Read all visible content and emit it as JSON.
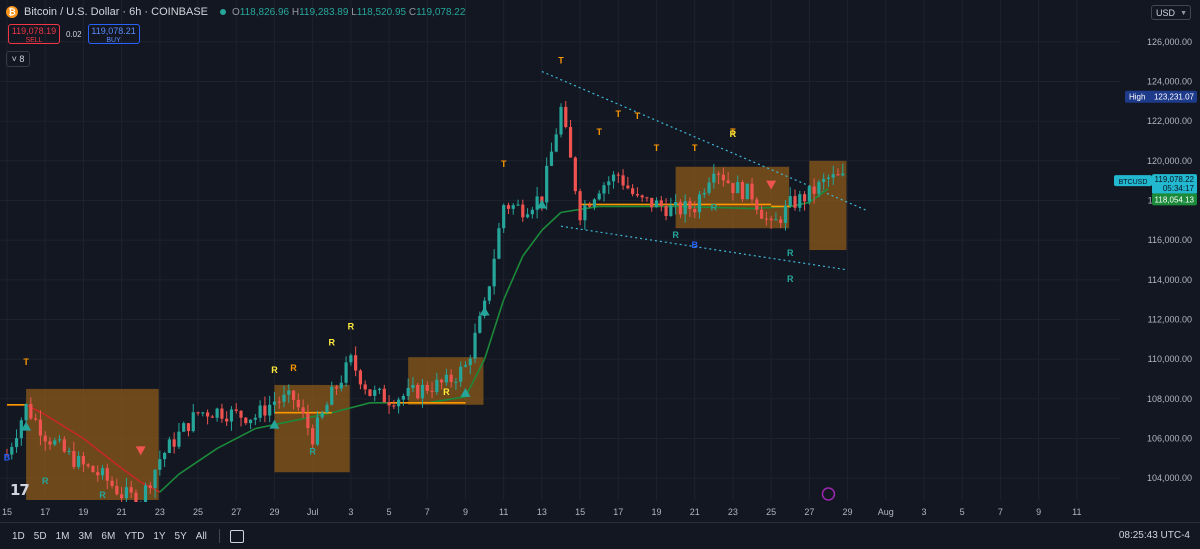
{
  "header": {
    "symbol": "Bitcoin / U.S. Dollar · 6h · COINBASE",
    "open_label": "O",
    "open": "118,826.96",
    "high_label": "H",
    "high": "119,283.89",
    "low_label": "L",
    "low": "118,520.95",
    "close_label": "C",
    "close": "119,078.22"
  },
  "trade": {
    "sell_price": "119,078.19",
    "sell_label": "SELL",
    "spread": "0.02",
    "buy_price": "119,078.21",
    "buy_label": "BUY"
  },
  "indicators_count": "8",
  "currency": "USD",
  "price_axis": {
    "ticks": [
      "126,000.00",
      "124,000.00",
      "122,000.00",
      "120,000.00",
      "118,000.00",
      "116,000.00",
      "114,000.00",
      "112,000.00",
      "110,000.00",
      "108,000.00",
      "106,000.00",
      "104,000.00"
    ],
    "tick_values": [
      126000,
      124000,
      122000,
      120000,
      118000,
      116000,
      114000,
      112000,
      110000,
      108000,
      106000,
      104000
    ],
    "high_tag_label": "High",
    "high_tag_value": "123,231.07",
    "high_value": 123231.07,
    "symbol_tag": "BTCUSD",
    "last_price": "119,078.22",
    "last_value": 119078.22,
    "countdown": "05:34:17",
    "ma_price": "118,054.13",
    "ma_value": 118054.13
  },
  "time_axis": {
    "labels": [
      "15",
      "17",
      "19",
      "21",
      "23",
      "25",
      "27",
      "29",
      "Jul",
      "3",
      "5",
      "7",
      "9",
      "11",
      "13",
      "15",
      "17",
      "19",
      "21",
      "23",
      "25",
      "27",
      "29",
      "Aug",
      "3",
      "5",
      "7",
      "9",
      "11"
    ]
  },
  "timeframes": [
    "1D",
    "5D",
    "1M",
    "3M",
    "6M",
    "YTD",
    "1Y",
    "5Y",
    "All"
  ],
  "clock": "08:25:43 UTC-4",
  "watermark": "17",
  "colors": {
    "bg": "#131722",
    "up": "#26a69a",
    "down": "#ef5350",
    "range_box": "#8b5a1a",
    "ma_up": "#1b8a3a",
    "ma_down": "#c62828",
    "trend": "#3fb8d8",
    "level": "#ff9800"
  },
  "chart_data": {
    "type": "candlestick",
    "title": "Bitcoin / U.S. Dollar · 6h · COINBASE",
    "xlabel": "",
    "ylabel": "",
    "ylim": [
      102900,
      127300
    ],
    "x_range": [
      "2025-06-15",
      "2025-08-12"
    ],
    "grid": true,
    "close_path": [
      {
        "t": "2025-06-15",
        "p": 105200
      },
      {
        "t": "2025-06-16",
        "p": 107600
      },
      {
        "t": "2025-06-17",
        "p": 106200
      },
      {
        "t": "2025-06-18",
        "p": 105300
      },
      {
        "t": "2025-06-19",
        "p": 104600
      },
      {
        "t": "2025-06-20",
        "p": 104100
      },
      {
        "t": "2025-06-21",
        "p": 103200
      },
      {
        "t": "2025-06-22",
        "p": 102900
      },
      {
        "t": "2025-06-23",
        "p": 105000
      },
      {
        "t": "2025-06-24",
        "p": 106200
      },
      {
        "t": "2025-06-25",
        "p": 107300
      },
      {
        "t": "2025-06-26",
        "p": 107400
      },
      {
        "t": "2025-06-27",
        "p": 107200
      },
      {
        "t": "2025-06-28",
        "p": 107100
      },
      {
        "t": "2025-06-29",
        "p": 107900
      },
      {
        "t": "2025-06-30",
        "p": 108000
      },
      {
        "t": "2025-07-01",
        "p": 106100
      },
      {
        "t": "2025-07-02",
        "p": 108200
      },
      {
        "t": "2025-07-03",
        "p": 109900
      },
      {
        "t": "2025-07-04",
        "p": 108300
      },
      {
        "t": "2025-07-05",
        "p": 108000
      },
      {
        "t": "2025-07-06",
        "p": 108200
      },
      {
        "t": "2025-07-07",
        "p": 108600
      },
      {
        "t": "2025-07-08",
        "p": 108800
      },
      {
        "t": "2025-07-09",
        "p": 109600
      },
      {
        "t": "2025-07-10",
        "p": 112600
      },
      {
        "t": "2025-07-11",
        "p": 117800
      },
      {
        "t": "2025-07-12",
        "p": 117600
      },
      {
        "t": "2025-07-13",
        "p": 118200
      },
      {
        "t": "2025-07-14",
        "p": 122600
      },
      {
        "t": "2025-07-15",
        "p": 117400
      },
      {
        "t": "2025-07-16",
        "p": 118700
      },
      {
        "t": "2025-07-17",
        "p": 119300
      },
      {
        "t": "2025-07-18",
        "p": 118000
      },
      {
        "t": "2025-07-19",
        "p": 117800
      },
      {
        "t": "2025-07-20",
        "p": 117500
      },
      {
        "t": "2025-07-21",
        "p": 117700
      },
      {
        "t": "2025-07-22",
        "p": 119800
      },
      {
        "t": "2025-07-23",
        "p": 118700
      },
      {
        "t": "2025-07-24",
        "p": 118300
      },
      {
        "t": "2025-07-25",
        "p": 116600
      },
      {
        "t": "2025-07-26",
        "p": 117800
      },
      {
        "t": "2025-07-27",
        "p": 118300
      },
      {
        "t": "2025-07-28",
        "p": 119100
      }
    ],
    "moving_average": [
      {
        "t": "2025-06-15",
        "p": 107700
      },
      {
        "t": "2025-06-16",
        "p": 107700
      },
      {
        "t": "2025-06-17",
        "p": 107200
      },
      {
        "t": "2025-06-19",
        "p": 106000
      },
      {
        "t": "2025-06-21",
        "p": 104500
      },
      {
        "t": "2025-06-22",
        "p": 103800
      },
      {
        "t": "2025-06-23",
        "p": 103300
      },
      {
        "t": "2025-06-24",
        "p": 104200
      },
      {
        "t": "2025-06-26",
        "p": 105500
      },
      {
        "t": "2025-06-28",
        "p": 106500
      },
      {
        "t": "2025-06-30",
        "p": 106900
      },
      {
        "t": "2025-07-02",
        "p": 107300
      },
      {
        "t": "2025-07-04",
        "p": 107800
      },
      {
        "t": "2025-07-07",
        "p": 107800
      },
      {
        "t": "2025-07-09",
        "p": 108100
      },
      {
        "t": "2025-07-10",
        "p": 110000
      },
      {
        "t": "2025-07-11",
        "p": 113000
      },
      {
        "t": "2025-07-12",
        "p": 115200
      },
      {
        "t": "2025-07-13",
        "p": 116500
      },
      {
        "t": "2025-07-14",
        "p": 117400
      },
      {
        "t": "2025-07-16",
        "p": 117700
      },
      {
        "t": "2025-07-20",
        "p": 117700
      },
      {
        "t": "2025-07-24",
        "p": 117600
      },
      {
        "t": "2025-07-26",
        "p": 117700
      },
      {
        "t": "2025-07-27",
        "p": 117900
      },
      {
        "t": "2025-07-28",
        "p": 118600
      }
    ],
    "range_boxes": [
      {
        "t0": "2025-06-16",
        "t1": "2025-06-22",
        "low": 102900,
        "high": 108500
      },
      {
        "t0": "2025-06-29",
        "t1": "2025-07-02",
        "low": 104300,
        "high": 108700
      },
      {
        "t0": "2025-07-06",
        "t1": "2025-07-09",
        "low": 107700,
        "high": 110100
      },
      {
        "t0": "2025-07-20",
        "t1": "2025-07-25",
        "low": 116600,
        "high": 119700
      },
      {
        "t0": "2025-07-27",
        "t1": "2025-07-28",
        "low": 115500,
        "high": 120000
      }
    ],
    "trend_lines": [
      {
        "t0": "2025-07-13",
        "p0": 124500,
        "t1": "2025-07-30",
        "p1": 117500
      },
      {
        "t0": "2025-07-14",
        "p0": 116700,
        "t1": "2025-07-29",
        "p1": 114500
      }
    ],
    "signal_labels": [
      {
        "text": "T",
        "t": "2025-06-16",
        "p": 109700,
        "color": "#ff9800"
      },
      {
        "text": "B",
        "t": "2025-06-15",
        "p": 104900,
        "color": "#2962ff"
      },
      {
        "text": "R",
        "t": "2025-06-17",
        "p": 103700,
        "color": "#26a69a"
      },
      {
        "text": "R",
        "t": "2025-06-20",
        "p": 103000,
        "color": "#26a69a"
      },
      {
        "text": "R",
        "t": "2025-06-29",
        "p": 109300,
        "color": "#ffeb3b"
      },
      {
        "text": "R",
        "t": "2025-06-30",
        "p": 109400,
        "color": "#ff9800"
      },
      {
        "text": "R",
        "t": "2025-07-01",
        "p": 105200,
        "color": "#26a69a"
      },
      {
        "text": "R",
        "t": "2025-07-02",
        "p": 110700,
        "color": "#ffeb3b"
      },
      {
        "text": "R",
        "t": "2025-07-03",
        "p": 111500,
        "color": "#ffeb3b"
      },
      {
        "text": "R",
        "t": "2025-07-08",
        "p": 108200,
        "color": "#ffeb3b"
      },
      {
        "text": "T",
        "t": "2025-07-11",
        "p": 119700,
        "color": "#ff9800"
      },
      {
        "text": "T",
        "t": "2025-07-14",
        "p": 124900,
        "color": "#ff9800"
      },
      {
        "text": "T",
        "t": "2025-07-16",
        "p": 121300,
        "color": "#ff9800"
      },
      {
        "text": "T",
        "t": "2025-07-17",
        "p": 122200,
        "color": "#ff9800"
      },
      {
        "text": "T",
        "t": "2025-07-18",
        "p": 122100,
        "color": "#ff9800"
      },
      {
        "text": "T",
        "t": "2025-07-19",
        "p": 120500,
        "color": "#ff9800"
      },
      {
        "text": "T",
        "t": "2025-07-21",
        "p": 120500,
        "color": "#ff9800"
      },
      {
        "text": "R",
        "t": "2025-07-20",
        "p": 116100,
        "color": "#26a69a"
      },
      {
        "text": "B",
        "t": "2025-07-21",
        "p": 115600,
        "color": "#2962ff"
      },
      {
        "text": "R",
        "t": "2025-07-22",
        "p": 117500,
        "color": "#26a69a"
      },
      {
        "text": "T",
        "t": "2025-07-23",
        "p": 121300,
        "color": "#ff9800"
      },
      {
        "text": "R",
        "t": "2025-07-23",
        "p": 121200,
        "color": "#ffeb3b"
      },
      {
        "text": "R",
        "t": "2025-07-26",
        "p": 115200,
        "color": "#26a69a"
      },
      {
        "text": "R",
        "t": "2025-07-26",
        "p": 113900,
        "color": "#26a69a"
      }
    ],
    "signal_arrows": [
      {
        "dir": "up",
        "t": "2025-06-16",
        "p": 106600,
        "color": "#26a69a"
      },
      {
        "dir": "down",
        "t": "2025-06-22",
        "p": 105400,
        "color": "#ef5350"
      },
      {
        "dir": "up",
        "t": "2025-06-29",
        "p": 106700,
        "color": "#26a69a"
      },
      {
        "dir": "up",
        "t": "2025-07-09",
        "p": 108300,
        "color": "#26a69a"
      },
      {
        "dir": "up",
        "t": "2025-07-10",
        "p": 112400,
        "color": "#26a69a"
      },
      {
        "dir": "up",
        "t": "2025-07-13",
        "p": 117800,
        "color": "#26a69a"
      },
      {
        "dir": "down",
        "t": "2025-07-25",
        "p": 118800,
        "color": "#ef5350"
      }
    ]
  }
}
